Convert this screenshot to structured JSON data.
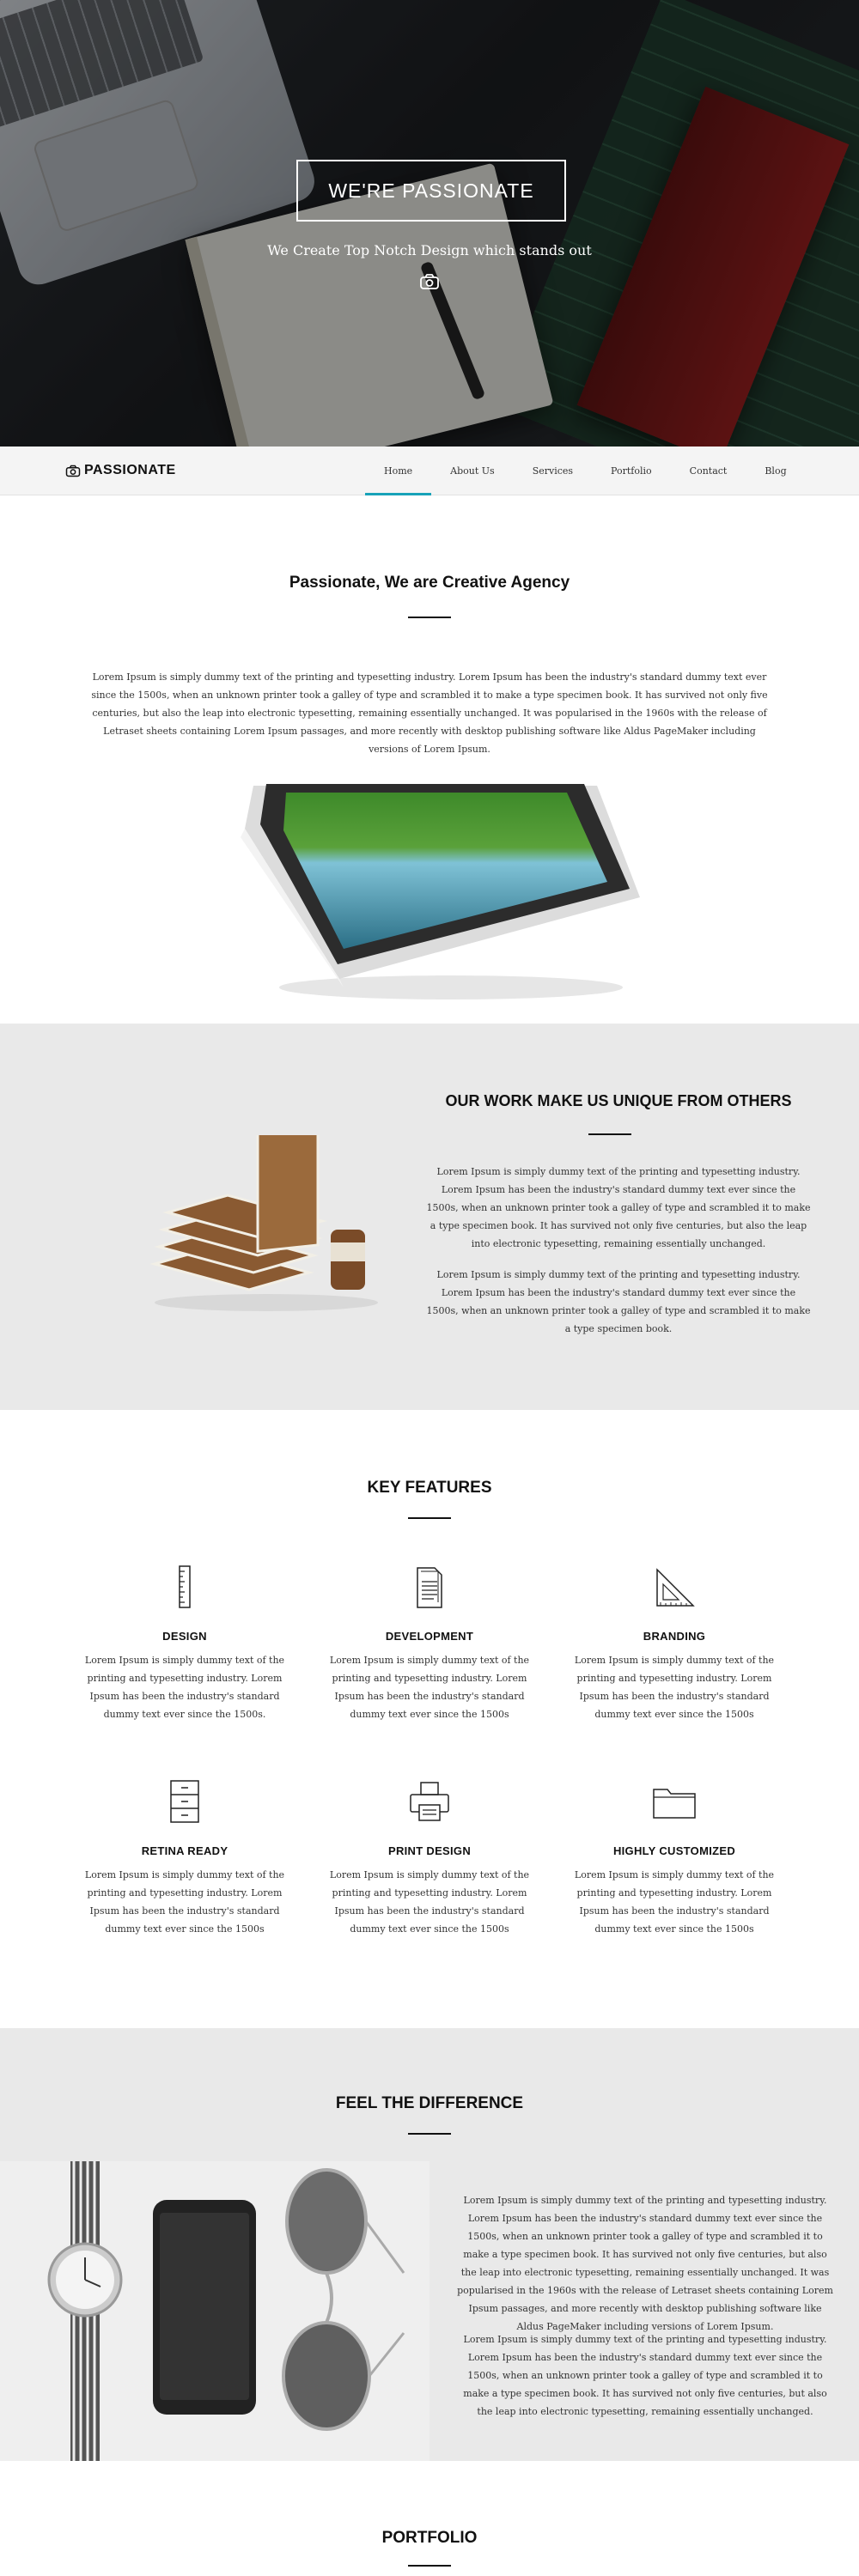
{
  "hero": {
    "title": "WE'RE PASSIONATE",
    "subtitle": "We Create Top Notch Design which stands out",
    "icon": "camera-icon"
  },
  "nav": {
    "logo_text": "PASSIONATE",
    "items": [
      {
        "label": "Home",
        "active": true
      },
      {
        "label": "About Us"
      },
      {
        "label": "Services"
      },
      {
        "label": "Portfolio"
      },
      {
        "label": "Contact"
      },
      {
        "label": "Blog"
      }
    ]
  },
  "about": {
    "title": "Passionate, We are Creative Agency",
    "text": "Lorem Ipsum is simply dummy text of the printing and typesetting industry. Lorem Ipsum has been the industry's standard dummy text ever since the 1500s, when an unknown printer took a galley of type and scrambled it to make a type specimen book. It has survived not only five centuries, but also the leap into electronic typesetting, remaining essentially unchanged. It was popularised in the 1960s with the release of Letraset sheets containing Lorem Ipsum passages, and more recently with desktop publishing software like Aldus PageMaker including versions of Lorem Ipsum."
  },
  "unique": {
    "title": "OUR WORK MAKE US UNIQUE FROM OTHERS",
    "p1": "Lorem Ipsum is simply dummy text of the printing and typesetting industry. Lorem Ipsum has been the industry's standard dummy text ever since the 1500s, when an unknown printer took a galley of type and scrambled it to make a type specimen book. It has survived not only five centuries, but also the leap into electronic typesetting, remaining essentially unchanged.",
    "p2": "Lorem Ipsum is simply dummy text of the printing and typesetting industry. Lorem Ipsum has been the industry's standard dummy text ever since the 1500s, when an unknown printer took a galley of type and scrambled it to make a type specimen book."
  },
  "features": {
    "title": "KEY FEATURES",
    "items": [
      {
        "name": "DESIGN",
        "icon": "ruler-icon",
        "text": "Lorem Ipsum is simply dummy text of the printing and typesetting industry. Lorem Ipsum has been the industry's standard dummy text ever since the 1500s."
      },
      {
        "name": "DEVELOPMENT",
        "icon": "document-icon",
        "text": "Lorem Ipsum is simply dummy text of the printing and typesetting industry. Lorem Ipsum has been the industry's standard dummy text ever since the 1500s"
      },
      {
        "name": "BRANDING",
        "icon": "set-square-icon",
        "text": "Lorem Ipsum is simply dummy text of the printing and typesetting industry. Lorem Ipsum has been the industry's standard dummy text ever since the 1500s"
      },
      {
        "name": "RETINA READY",
        "icon": "cabinet-icon",
        "text": "Lorem Ipsum is simply dummy text of the printing and typesetting industry. Lorem Ipsum has been the industry's standard dummy text ever since the 1500s"
      },
      {
        "name": "PRINT DESIGN",
        "icon": "printer-icon",
        "text": "Lorem Ipsum is simply dummy text of the printing and typesetting industry. Lorem Ipsum has been the industry's standard dummy text ever since the 1500s"
      },
      {
        "name": "HIGHLY CUSTOMIZED",
        "icon": "folder-icon",
        "text": "Lorem Ipsum is simply dummy text of the printing and typesetting industry. Lorem Ipsum has been the industry's standard dummy text ever since the 1500s"
      }
    ]
  },
  "difference": {
    "title": "FEEL THE DIFFERENCE",
    "p1": "Lorem Ipsum is simply dummy text of the printing and typesetting industry. Lorem Ipsum has been the industry's standard dummy text ever since the 1500s, when an unknown printer took a galley of type and scrambled it to make a type specimen book. It has survived not only five centuries, but also the leap into electronic typesetting, remaining essentially unchanged. It was popularised in the 1960s with the release of Letraset sheets containing Lorem Ipsum passages, and more recently with desktop publishing software like Aldus PageMaker including versions of Lorem Ipsum.",
    "p2": "Lorem Ipsum is simply dummy text of the printing and typesetting industry. Lorem Ipsum has been the industry's standard dummy text ever since the 1500s, when an unknown printer took a galley of type and scrambled it to make a type specimen book. It has survived not only five centuries, but also the leap into electronic typesetting, remaining essentially unchanged."
  },
  "portfolio": {
    "title": "PORTFOLIO"
  },
  "colors": {
    "accent": "#17a2b8",
    "section_gray": "#e9e9e9",
    "nav_bg": "#f4f4f4"
  }
}
